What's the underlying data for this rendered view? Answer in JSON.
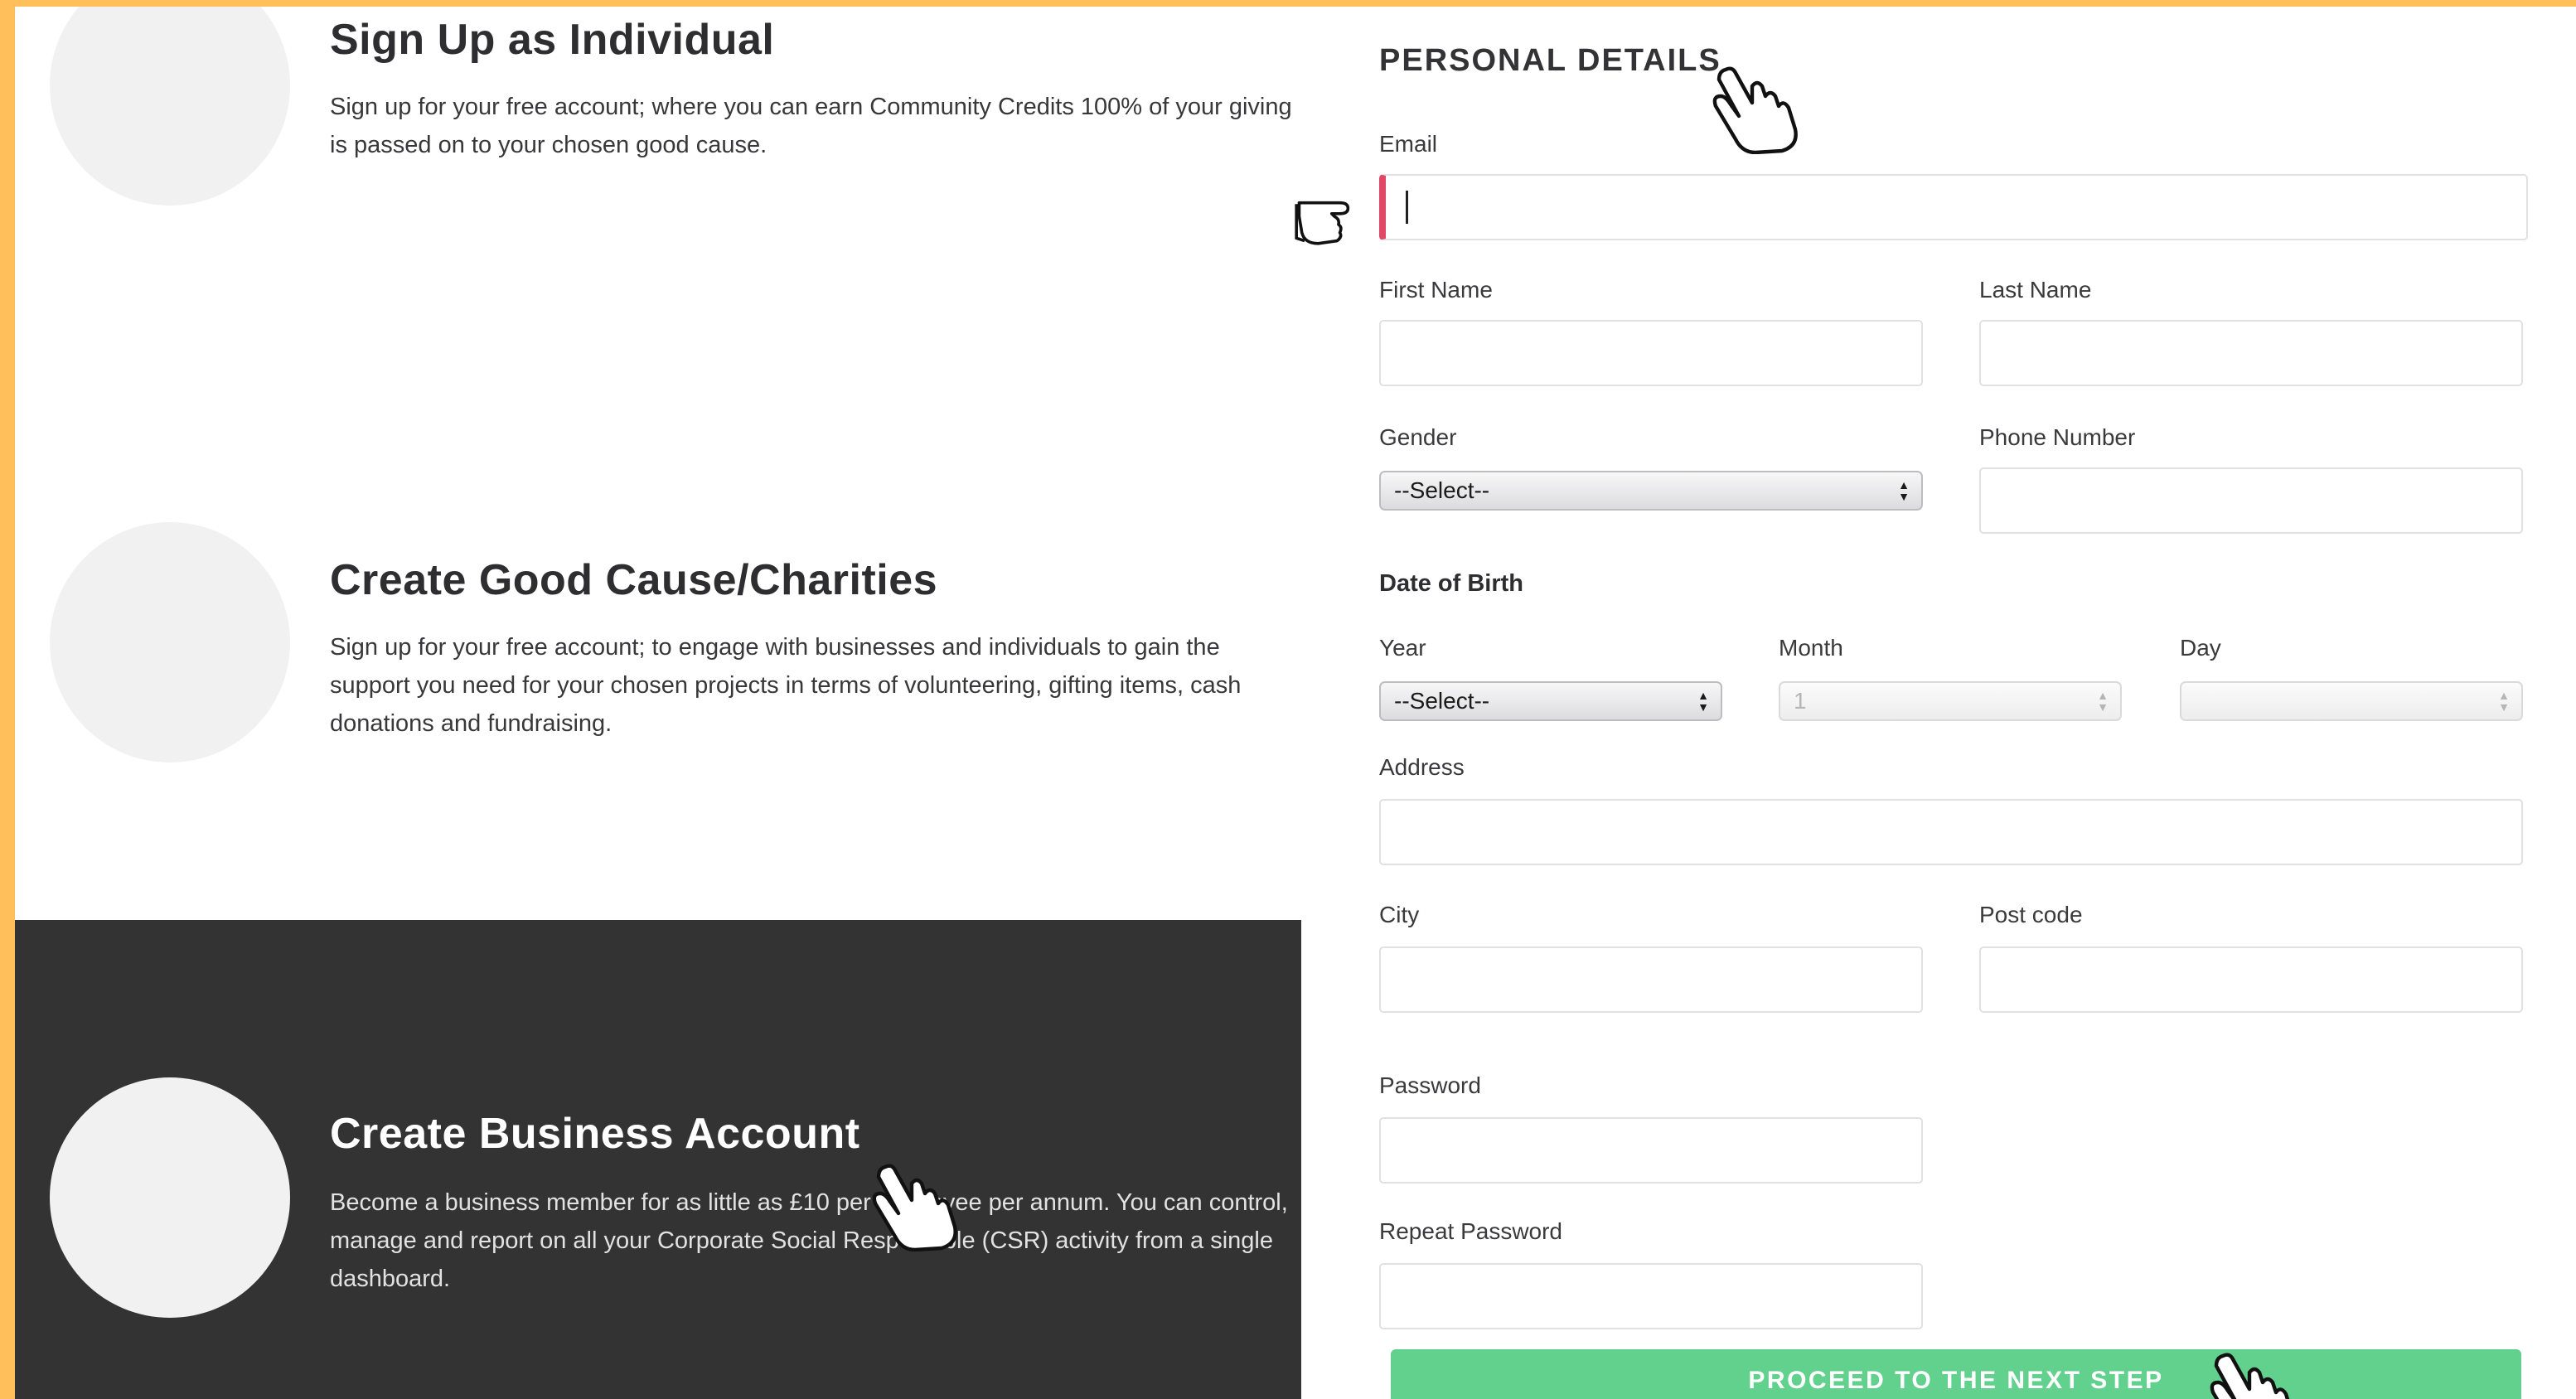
{
  "options": {
    "individual": {
      "title": "Sign Up as Individual",
      "description": "Sign up for your free account; where you can earn Community Credits 100% of your giving is passed on to your chosen good cause."
    },
    "charity": {
      "title": "Create Good Cause/Charities",
      "description": "Sign up for your free account; to engage with businesses and individuals to gain the support you need for your chosen projects in terms of volunteering, gifting items, cash donations and fundraising."
    },
    "business": {
      "title": "Create Business Account",
      "description": "Become a business member for as little as £10 per employee per annum. You can control, manage and report on all your Corporate Social Responsible (CSR) activity from a single dashboard."
    }
  },
  "form": {
    "section_title": "PERSONAL DETAILS",
    "email_label": "Email",
    "first_name_label": "First Name",
    "last_name_label": "Last Name",
    "gender_label": "Gender",
    "gender_value": "--Select--",
    "phone_label": "Phone Number",
    "dob_label": "Date of Birth",
    "year_label": "Year",
    "year_value": "--Select--",
    "month_label": "Month",
    "month_value": "1",
    "day_label": "Day",
    "day_value": "",
    "address_label": "Address",
    "city_label": "City",
    "postcode_label": "Post code",
    "password_label": "Password",
    "repeat_password_label": "Repeat Password",
    "proceed_label": "PROCEED TO THE NEXT STEP"
  },
  "colors": {
    "page_border": "#ffbf5a",
    "dark_panel": "#333334",
    "proceed_button": "#62d18d",
    "active_field_accent": "#e04868"
  },
  "icons": {
    "cursor_overlays": [
      "hand-pointer-icon",
      "pointing-hand-icon",
      "hand-pointer-icon",
      "hand-pointer-icon"
    ]
  }
}
